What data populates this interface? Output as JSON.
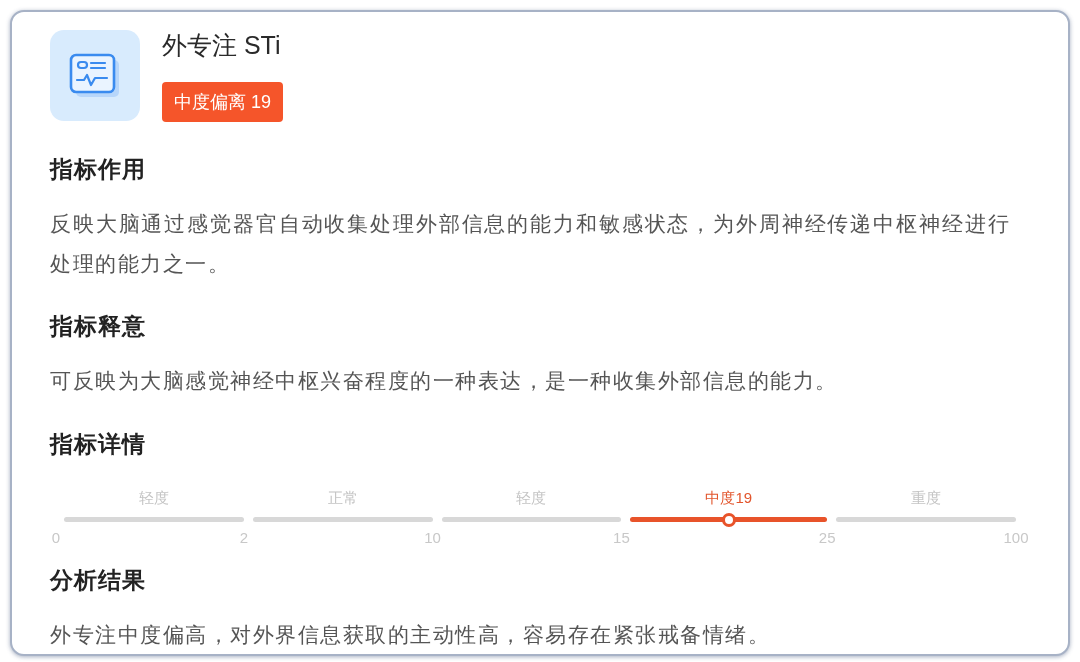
{
  "header": {
    "title": "外专注 STi",
    "badge": "中度偏离 19"
  },
  "sections": [
    {
      "kind": "text",
      "heading": "指标作用",
      "body": "反映大脑通过感觉器官自动收集处理外部信息的能力和敏感状态，为外周神经传递中枢神经进行处理的能力之一。"
    },
    {
      "kind": "text",
      "heading": "指标释意",
      "body": "可反映为大脑感觉神经中枢兴奋程度的一种表达，是一种收集外部信息的能力。"
    },
    {
      "kind": "scale",
      "heading": "指标详情",
      "segments": [
        {
          "label": "轻度",
          "selected": false
        },
        {
          "label": "正常",
          "selected": false
        },
        {
          "label": "轻度",
          "selected": false
        },
        {
          "label": "中度19",
          "selected": true,
          "level": 0.5
        },
        {
          "label": "重度",
          "selected": false
        }
      ],
      "ticks": [
        "0",
        "2",
        "10",
        "15",
        "25",
        "100"
      ]
    },
    {
      "kind": "text",
      "heading": "分析结果",
      "body": "外专注中度偏高，对外界信息获取的主动性高，容易存在紧张戒备情绪。"
    }
  ]
}
